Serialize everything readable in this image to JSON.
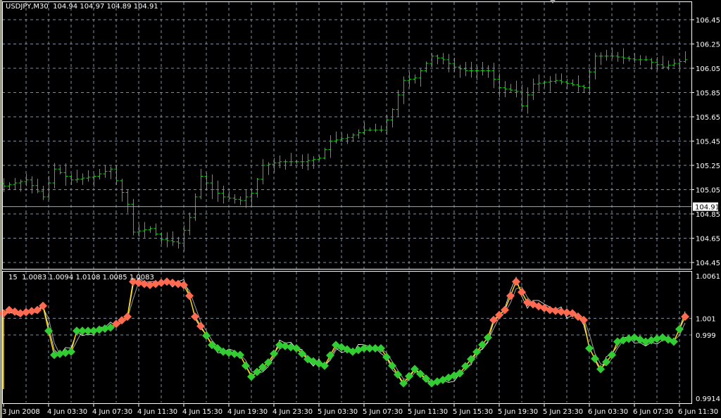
{
  "header": {
    "symbol": "USDJPY,M30",
    "open": "104.94",
    "high": "104.97",
    "low": "104.89",
    "close": "104.91"
  },
  "indicator_header": {
    "period": "15",
    "values": [
      "1.0083",
      "1.0094",
      "1.0108",
      "1.0085",
      "1.0083"
    ]
  },
  "current_price_label": "104.91",
  "colors": {
    "bars": "#00e000",
    "grid": "#8090a0",
    "up_marker": "#ff6a50",
    "down_marker": "#32cd32",
    "line_main": "#ffd700",
    "line_fast": "#ffffff",
    "line_slow": "#a0a0a0"
  },
  "chart_data": [
    {
      "type": "ohlc",
      "title": "USDJPY,M30",
      "yticks": [
        "106.45",
        "106.25",
        "106.05",
        "105.85",
        "105.65",
        "105.45",
        "105.25",
        "105.05",
        "104.85",
        "104.65",
        "104.45"
      ],
      "ylim": [
        104.43,
        106.57
      ],
      "xticks": [
        "3 Jun 2008",
        "4 Jun 03:30",
        "4 Jun 07:30",
        "4 Jun 11:30",
        "4 Jun 15:30",
        "4 Jun 19:30",
        "4 Jun 23:30",
        "5 Jun 03:30",
        "5 Jun 07:30",
        "5 Jun 11:30",
        "5 Jun 15:30",
        "5 Jun 19:30",
        "5 Jun 23:30",
        "6 Jun 03:30",
        "6 Jun 07:30",
        "6 Jun 11:30"
      ],
      "bar_count": 122,
      "close_keypoints": [
        [
          0,
          105.08
        ],
        [
          4,
          105.13
        ],
        [
          7,
          104.99
        ],
        [
          9,
          105.22
        ],
        [
          12,
          105.13
        ],
        [
          16,
          105.16
        ],
        [
          19,
          105.22
        ],
        [
          22,
          104.93
        ],
        [
          23,
          104.7
        ],
        [
          26,
          104.73
        ],
        [
          28,
          104.64
        ],
        [
          31,
          104.61
        ],
        [
          33,
          104.82
        ],
        [
          35,
          105.16
        ],
        [
          37,
          105.05
        ],
        [
          39,
          104.99
        ],
        [
          42,
          104.96
        ],
        [
          44,
          105.02
        ],
        [
          46,
          105.25
        ],
        [
          49,
          105.28
        ],
        [
          53,
          105.28
        ],
        [
          56,
          105.31
        ],
        [
          58,
          105.45
        ],
        [
          61,
          105.48
        ],
        [
          64,
          105.54
        ],
        [
          67,
          105.54
        ],
        [
          69,
          105.71
        ],
        [
          71,
          105.95
        ],
        [
          73,
          105.97
        ],
        [
          76,
          106.15
        ],
        [
          78,
          106.12
        ],
        [
          80,
          106.06
        ],
        [
          82,
          106.03
        ],
        [
          86,
          106.03
        ],
        [
          88,
          105.89
        ],
        [
          91,
          105.86
        ],
        [
          92,
          105.74
        ],
        [
          94,
          105.92
        ],
        [
          98,
          105.95
        ],
        [
          103,
          105.89
        ],
        [
          105,
          106.15
        ],
        [
          108,
          106.15
        ],
        [
          112,
          106.12
        ],
        [
          114,
          106.12
        ],
        [
          117,
          106.06
        ],
        [
          121,
          106.12
        ]
      ],
      "grid": true
    },
    {
      "type": "line",
      "title": "15",
      "yticks": [
        "1.0061",
        "1.001",
        "0.999",
        "0.9914"
      ],
      "ylim": [
        0.9905,
        1.007
      ],
      "threshold": 1.0,
      "value_keypoints": [
        [
          0,
          1.0016
        ],
        [
          1,
          1.002
        ],
        [
          3,
          1.0016
        ],
        [
          6,
          1.002
        ],
        [
          7,
          1.0025
        ],
        [
          8,
          0.9995
        ],
        [
          9,
          0.9966
        ],
        [
          12,
          0.997
        ],
        [
          13,
          0.9995
        ],
        [
          16,
          0.9995
        ],
        [
          19,
          0.9999
        ],
        [
          22,
          1.0012
        ],
        [
          23,
          1.0054
        ],
        [
          26,
          1.005
        ],
        [
          29,
          1.0054
        ],
        [
          32,
          1.005
        ],
        [
          33,
          1.0037
        ],
        [
          34,
          1.0012
        ],
        [
          37,
          0.9978
        ],
        [
          39,
          0.997
        ],
        [
          42,
          0.9966
        ],
        [
          44,
          0.994
        ],
        [
          47,
          0.9957
        ],
        [
          49,
          0.9978
        ],
        [
          52,
          0.9974
        ],
        [
          54,
          0.9961
        ],
        [
          57,
          0.9953
        ],
        [
          59,
          0.9978
        ],
        [
          62,
          0.997
        ],
        [
          64,
          0.9974
        ],
        [
          67,
          0.9974
        ],
        [
          69,
          0.9953
        ],
        [
          71,
          0.9932
        ],
        [
          73,
          0.9949
        ],
        [
          76,
          0.9932
        ],
        [
          78,
          0.9936
        ],
        [
          81,
          0.9944
        ],
        [
          83,
          0.9961
        ],
        [
          86,
          0.9987
        ],
        [
          87,
          1.0008
        ],
        [
          89,
          1.002
        ],
        [
          91,
          1.0054
        ],
        [
          93,
          1.0029
        ],
        [
          97,
          1.002
        ],
        [
          101,
          1.0016
        ],
        [
          103,
          1.0008
        ],
        [
          104,
          0.9974
        ],
        [
          106,
          0.9949
        ],
        [
          108,
          0.9966
        ],
        [
          109,
          0.9982
        ],
        [
          112,
          0.9987
        ],
        [
          114,
          0.9982
        ],
        [
          117,
          0.9987
        ],
        [
          119,
          0.9982
        ],
        [
          121,
          1.0012
        ]
      ]
    }
  ]
}
